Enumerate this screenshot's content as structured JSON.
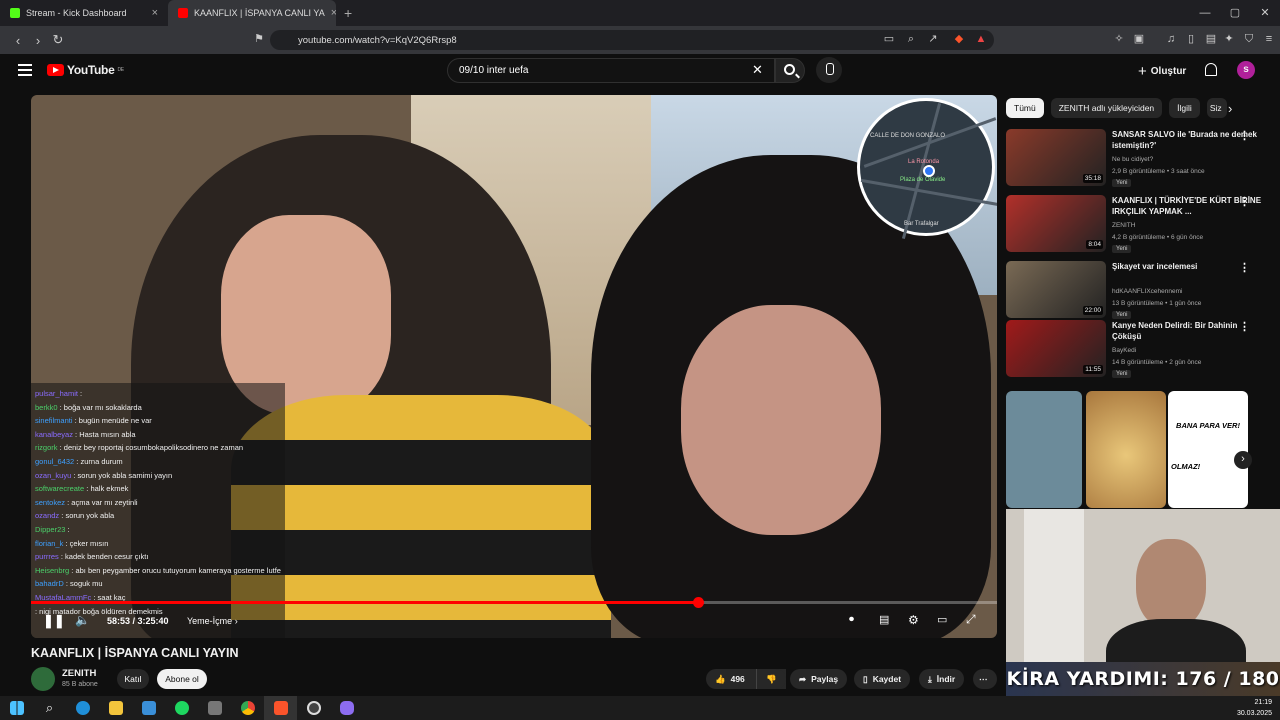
{
  "browser": {
    "tabs": [
      {
        "label": "Stream - Kick Dashboard",
        "active": false,
        "favicon_color": "#53fc18"
      },
      {
        "label": "KAANFLIX | İSPANYA CANLI YA",
        "active": true,
        "favicon_color": "#ff0000"
      }
    ],
    "url": "youtube.com/watch?v=KqV2Q6Rrsp8"
  },
  "youtube": {
    "logo_text": "YouTube",
    "logo_region": "DE",
    "search_value": "09/10 inter uefa",
    "create_label": "Oluştur",
    "avatar_letter": "s"
  },
  "video": {
    "map_labels": [
      "CALLE DE DON GONZALO",
      "La Rotonda",
      "Plaza de Olavide",
      "Bar Trafalgar"
    ],
    "chat": [
      {
        "user": "pulsar_hamit",
        "msg": ""
      },
      {
        "user": "berkk0",
        "msg": "boğa var mı sokaklarda"
      },
      {
        "user": "sinefilmanti",
        "msg": "bugün menüde ne var"
      },
      {
        "user": "kanalbeyaz",
        "msg": "Hasta mısın abla"
      },
      {
        "user": "rizgork",
        "msg": "deniz bey roportaj cosumbokapoliksodinero ne zaman"
      },
      {
        "user": "gonul_6432",
        "msg": "zurna durum"
      },
      {
        "user": "ozan_kuyu",
        "msg": "sorun yok abla samimi yayın"
      },
      {
        "user": "softwarecreate",
        "msg": "halk ekmek"
      },
      {
        "user": "sentokez",
        "msg": "açma var mı zeytinli"
      },
      {
        "user": "ozandz",
        "msg": "sorun yok abla"
      },
      {
        "user": "Dipper23",
        "msg": ""
      },
      {
        "user": "florian_k",
        "msg": "çeker mısın"
      },
      {
        "user": "purrres",
        "msg": "kadek benden cesur çıktı"
      },
      {
        "user": "Heisenbrg",
        "msg": "abı ben peygamber orucu tutuyorum kameraya gosterme lutfen"
      },
      {
        "user": "bahadrD",
        "msg": "soguk mu"
      },
      {
        "user": "MustafaLamrnFc",
        "msg": "saat kaç"
      },
      {
        "user": "",
        "msg": "nigi matador boğa öldüren demekmis"
      }
    ],
    "progress_fraction": 0.69,
    "time_label": "58:53 / 3:25:40",
    "chapter_label": "Yeme-İçme"
  },
  "meta": {
    "title": "KAANFLIX | İSPANYA CANLI YAYIN",
    "channel": "ZENITH",
    "subs": "85 B abone",
    "join_label": "Katıl",
    "subscribe_label": "Abone ol",
    "likes": "496",
    "share_label": "Paylaş",
    "save_label": "Kaydet",
    "download_label": "İndir"
  },
  "sidebar": {
    "chips": [
      "Tümü",
      "ZENITH adlı yükleyiciden",
      "İlgili",
      "Siz"
    ],
    "recs": [
      {
        "title": "SANSAR SALVO ile 'Burada ne demek istemiştin?'",
        "channel": "Ne bu cidiyet?",
        "meta": "2,9 B görüntüleme • 3 saat önce",
        "badge": "Yeni",
        "duration": "35:18",
        "thumb_color": "#8a3a2a"
      },
      {
        "title": "KAANFLIX | TÜRKİYE'DE KÜRT BİRİNE IRKÇILIK YAPMAK ...",
        "channel": "ZENITH",
        "meta": "4,2 B görüntüleme • 6 gün önce",
        "badge": "Yeni",
        "duration": "8:04",
        "thumb_color": "#b2302a"
      },
      {
        "title": "Şikayet var incelemesi",
        "channel": "hdKAANFLIXcehennemi",
        "meta": "13 B görüntüleme • 1 gün önce",
        "badge": "Yeni",
        "duration": "22:00",
        "thumb_color": "#7a6a55"
      },
      {
        "title": "Kanye Neden Delirdi: Bir Dahinin Çöküşü",
        "channel": "BayKedi",
        "meta": "14 B görüntüleme • 2 gün önce",
        "badge": "Yeni",
        "duration": "11:55",
        "thumb_color": "#a11a1a"
      }
    ],
    "shorts": {
      "short3_line1": "BANA PARA VER!",
      "short3_line2": "OLMAZ!"
    }
  },
  "webcam": {
    "banner": "KİRA YARDIMI: 176 / 180"
  },
  "taskbar": {
    "time": "21:19",
    "date": "30.03.2025"
  }
}
